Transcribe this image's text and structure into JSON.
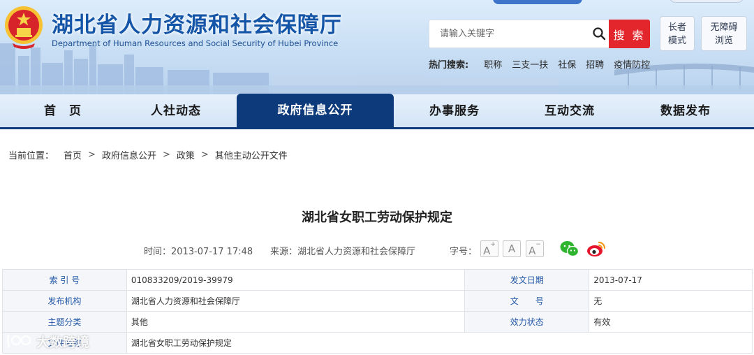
{
  "header": {
    "title": "湖北省人力资源和社会保障厅",
    "subtitle": "Department of Human Resources and Social Security of Hubei Province",
    "search_placeholder": "请输入关键字",
    "search_button": "搜 索",
    "elder_mode": [
      "长者",
      "模式"
    ],
    "accessible": [
      "无障碍",
      "浏览"
    ],
    "hot_label": "热门搜索:",
    "hot_items": [
      "职称",
      "三支一扶",
      "社保",
      "招聘",
      "疫情防控"
    ]
  },
  "nav": {
    "items": [
      "首　页",
      "人社动态",
      "政府信息公开",
      "办事服务",
      "互动交流",
      "数据发布"
    ],
    "active_index": 2
  },
  "breadcrumb": {
    "label": "当前位置：",
    "items": [
      "首页",
      "政府信息公开",
      "政策",
      "其他主动公开文件"
    ],
    "separator": ">"
  },
  "article": {
    "title": "湖北省女职工劳动保护规定",
    "time": "时间：2013-07-17 17:48",
    "source": "来源：湖北省人力资源和社会保障厅",
    "font_label": "字号：",
    "font_buttons": [
      "A",
      "A",
      "A"
    ]
  },
  "info": {
    "index_label": "索 引 号",
    "index_value": "010833209/2019-39979",
    "date_label": "发文日期",
    "date_value": "2013-07-17",
    "org_label": "发布机构",
    "org_value": "湖北省人力资源和社会保障厅",
    "docno_label": "文　　号",
    "docno_value": "无",
    "topic_label": "主题分类",
    "topic_value": "其他",
    "status_label": "效力状态",
    "status_value": "有效",
    "name_label": "文件名称",
    "name_value": "湖北省女职工劳动保护规定"
  },
  "watermark": "大数跨境",
  "colors": {
    "brand_blue": "#1455a8",
    "nav_active": "#0d3a7a",
    "search_red": "#e3262b",
    "table_key": "#2459a8"
  }
}
